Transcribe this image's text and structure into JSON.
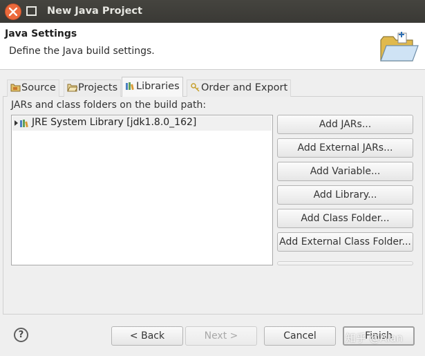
{
  "window": {
    "title": "New Java Project",
    "close_icon": "close-icon",
    "maximize_icon": "maximize-icon"
  },
  "header": {
    "title": "Java Settings",
    "description": "Define the Java build settings.",
    "icon": "new-project-folder-icon"
  },
  "tabs": [
    {
      "label": "Source",
      "icon": "source-folder-icon",
      "active": false
    },
    {
      "label": "Projects",
      "icon": "projects-folder-icon",
      "active": false
    },
    {
      "label": "Libraries",
      "icon": "libraries-icon",
      "active": true
    },
    {
      "label": "Order and Export",
      "icon": "order-export-icon",
      "active": false
    }
  ],
  "libraries": {
    "label": "JARs and class folders on the build path:",
    "items": [
      {
        "label": "JRE System Library [jdk1.8.0_162]",
        "icon": "library-icon",
        "expanded": false
      }
    ],
    "buttons": [
      {
        "label": "Add JARs..."
      },
      {
        "label": "Add External JARs..."
      },
      {
        "label": "Add Variable..."
      },
      {
        "label": "Add Library..."
      },
      {
        "label": "Add Class Folder..."
      },
      {
        "label": "Add External Class Folder..."
      }
    ]
  },
  "footer": {
    "help_icon": "help-icon",
    "help_glyph": "?",
    "back_label": "< Back",
    "next_label": "Next >",
    "cancel_label": "Cancel",
    "finish_label": "Finish"
  },
  "watermark": "知乎 @Alan",
  "colors": {
    "titlebar": "#3c3b37",
    "close_button": "#ec6a3c",
    "header_bg": "#ffffff",
    "dialog_bg": "#efefef"
  }
}
